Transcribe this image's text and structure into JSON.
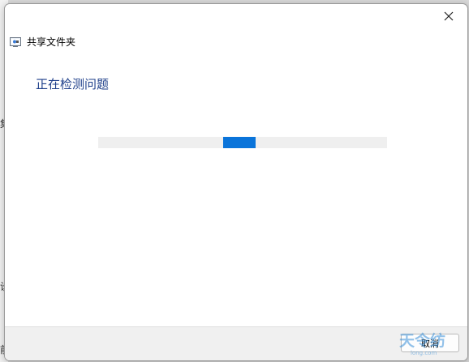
{
  "dialog": {
    "title": "共享文件夹",
    "heading": "正在检测问题",
    "cancel_label": "取消"
  },
  "background": {
    "glyphs": [
      "集",
      "设",
      "前"
    ]
  },
  "progress": {
    "state": "indeterminate",
    "color": "#0a74da"
  },
  "icons": {
    "close": "close-icon",
    "app": "shared-folder-troubleshooter-icon",
    "watermark": "site-logo"
  }
}
